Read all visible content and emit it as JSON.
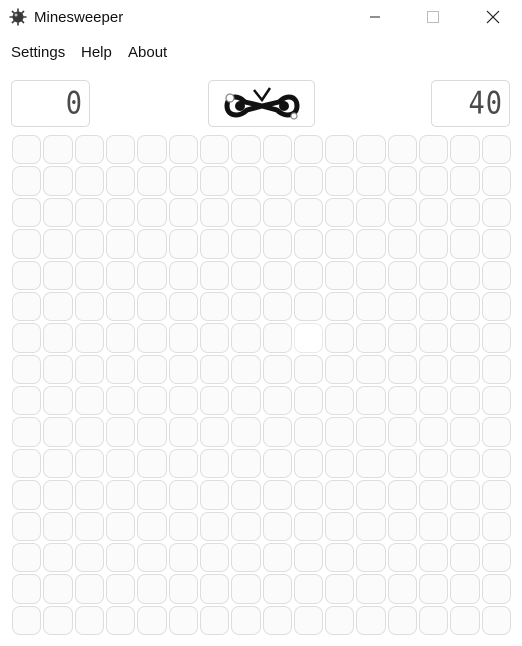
{
  "window": {
    "title": "Minesweeper",
    "app_icon": "mine-icon"
  },
  "menu": {
    "items": [
      "Settings",
      "Help",
      "About"
    ]
  },
  "status": {
    "mines_display": "0",
    "timer_display": "40",
    "face_icon": "goggles-face-icon"
  },
  "board": {
    "rows": 16,
    "cols": 16,
    "highlighted_cell": {
      "row": 6,
      "col": 9
    }
  }
}
